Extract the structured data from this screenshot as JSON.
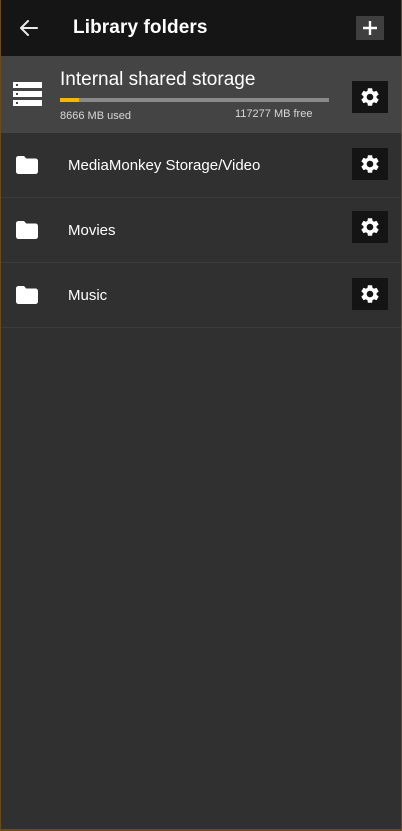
{
  "appbar": {
    "title": "Library folders",
    "back_icon": "arrow-left-icon",
    "add_icon": "plus-icon"
  },
  "storage": {
    "name": "Internal shared storage",
    "used_text": "8666 MB used",
    "free_text": "117277 MB free",
    "used_fraction": 0.069,
    "icon": "storage-drive-icon",
    "settings_icon": "gear-icon"
  },
  "folders": [
    {
      "label": "MediaMonkey Storage/Video",
      "icon": "folder-icon",
      "settings_icon": "gear-icon"
    },
    {
      "label": "Movies",
      "icon": "folder-icon",
      "settings_icon": "gear-icon"
    },
    {
      "label": "Music",
      "icon": "folder-icon",
      "settings_icon": "gear-icon"
    }
  ],
  "colors": {
    "progress_fill": "#f5b800",
    "background": "#303030",
    "appbar": "#151515"
  }
}
